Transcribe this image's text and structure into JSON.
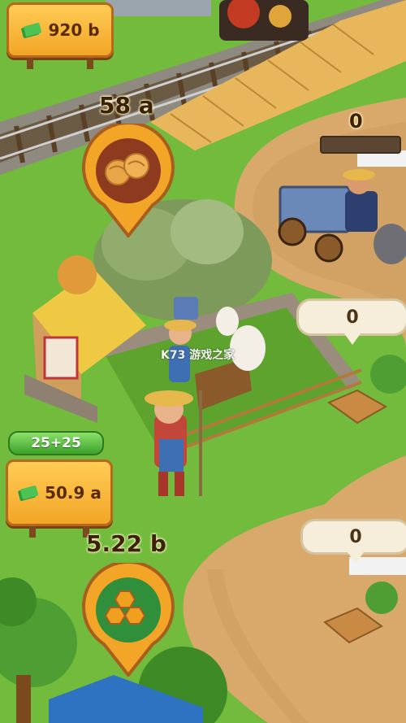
{
  "hud": {
    "cash_total": "920 b",
    "cash_icon": "cash-stack-icon",
    "colors": {
      "sign": "#f2a526",
      "sign_border": "#b7681a",
      "text": "#5a2c06"
    }
  },
  "wool_station": {
    "amount": "58 a",
    "icon": "wool-yarn-icon"
  },
  "train_cart": {
    "count": "0",
    "progress_fraction": 0.0
  },
  "delivery_bubbles": [
    {
      "value": "0"
    },
    {
      "value": "0"
    }
  ],
  "alpaca_farm": {
    "upgrade_badge": "25+25",
    "income": "50.9 a",
    "income_icon": "cash-stack-icon"
  },
  "honey_station": {
    "amount": "5.22 b",
    "icon": "honeycomb-icon"
  },
  "watermark": "K73 游戏之家"
}
